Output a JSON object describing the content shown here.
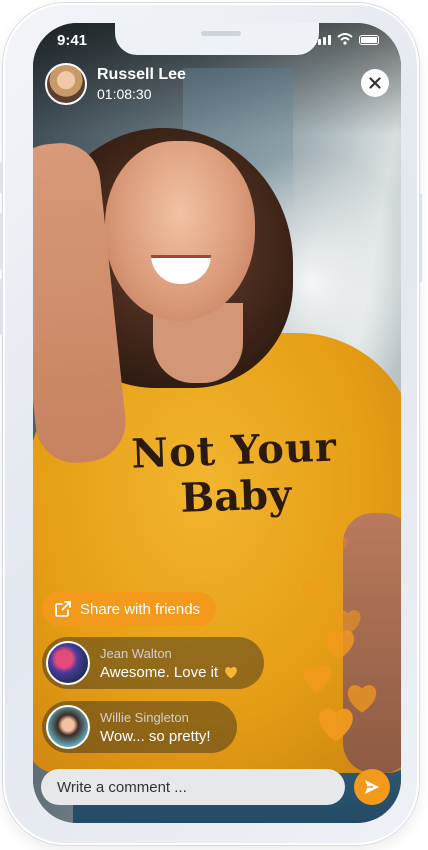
{
  "status": {
    "time": "9:41"
  },
  "host": {
    "name": "Russell Lee",
    "timer": "01:08:30"
  },
  "shirt": {
    "line1": "Not Your",
    "line2": "Baby"
  },
  "share": {
    "label": "Share with friends"
  },
  "comments": [
    {
      "name": "Jean Walton",
      "message": "Awesome. Love it",
      "has_heart": true
    },
    {
      "name": "Willie Singleton",
      "message": "Wow... so pretty!",
      "has_heart": false
    }
  ],
  "composer": {
    "placeholder": "Write a comment ..."
  },
  "colors": {
    "accent": "#f39a1c",
    "heart": "#f39a1c"
  },
  "icons": {
    "close": "close-icon",
    "share": "share-icon",
    "send": "send-icon"
  }
}
